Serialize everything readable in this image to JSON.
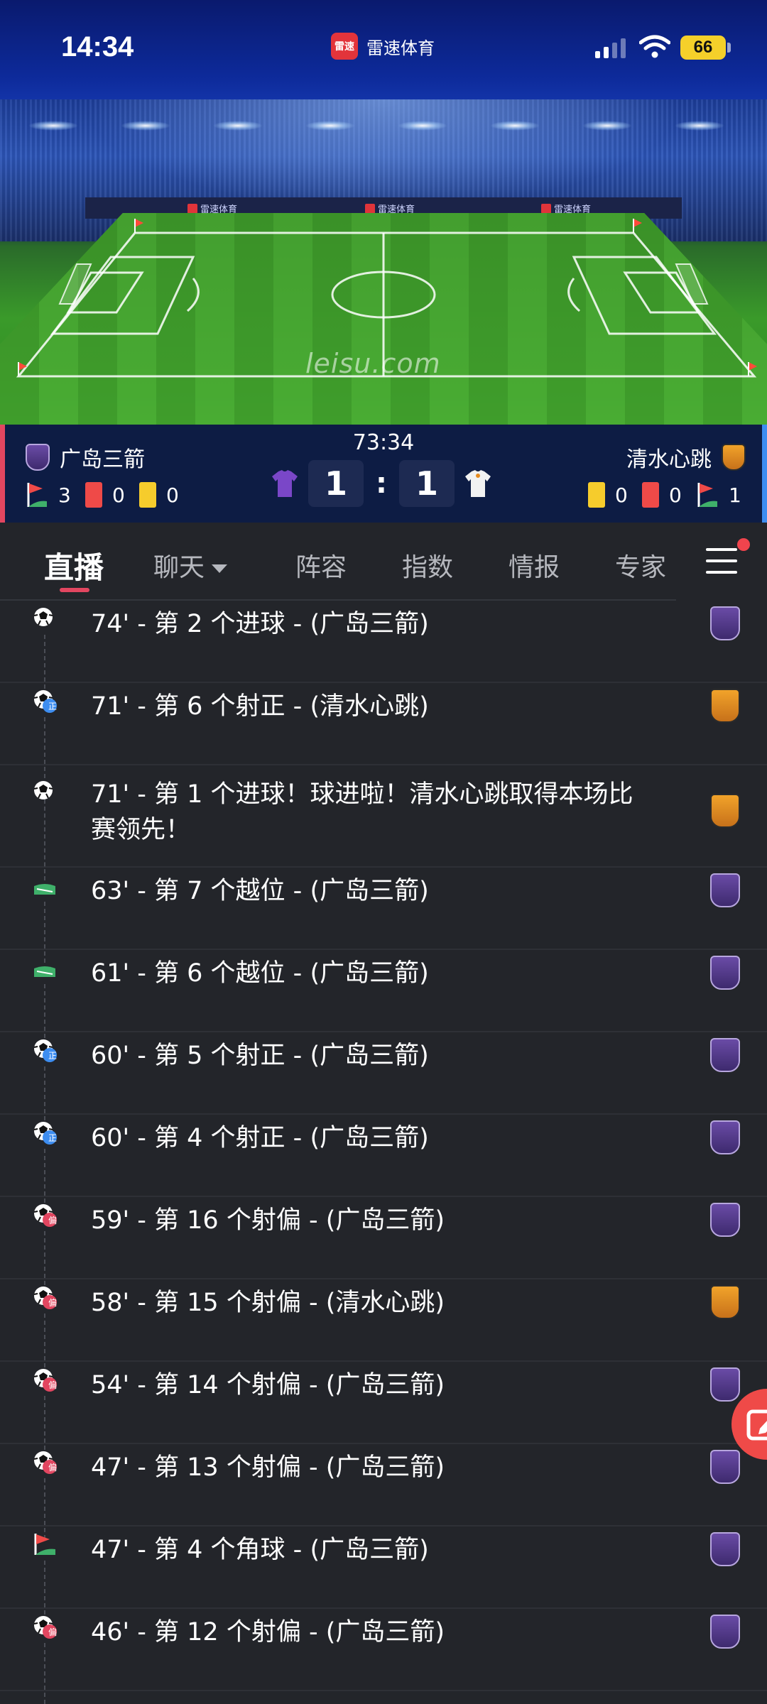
{
  "status_bar": {
    "time": "14:34",
    "app_name": "雷速体育",
    "app_logo_text": "雷速",
    "battery": "66"
  },
  "hero": {
    "watermark": "leisu.com",
    "adboard_text": "雷速体育"
  },
  "match": {
    "clock": "73:34",
    "home": {
      "name": "广岛三箭",
      "corners": "3",
      "red_cards": "0",
      "yellow_cards": "0",
      "score": "1",
      "crest_color": "#5a3f94"
    },
    "away": {
      "name": "清水心跳",
      "corners": "1",
      "red_cards": "0",
      "yellow_cards": "0",
      "score": "1",
      "crest_color": "#e58b20"
    },
    "colon": ":"
  },
  "tabs": [
    {
      "label": "直播",
      "active": true
    },
    {
      "label": "聊天",
      "has_dropdown": true
    },
    {
      "label": "阵容"
    },
    {
      "label": "指数"
    },
    {
      "label": "情报"
    },
    {
      "label": "专家"
    }
  ],
  "events": [
    {
      "text": "74' - 第 2 个进球 - (广岛三箭)",
      "icon": "football-icon",
      "team": "home"
    },
    {
      "text": "71' - 第 6 个射正 - (清水心跳)",
      "icon": "shot-on-target-icon",
      "badge": "正",
      "team": "away"
    },
    {
      "text": "71' - 第 1 个进球！球进啦！清水心跳取得本场比",
      "text2": "赛领先！",
      "icon": "football-icon",
      "team": "away"
    },
    {
      "text": "63' - 第 7 个越位 - (广岛三箭)",
      "icon": "offside-icon",
      "team": "home"
    },
    {
      "text": "61' - 第 6 个越位 - (广岛三箭)",
      "icon": "offside-icon",
      "team": "home"
    },
    {
      "text": "60' - 第 5 个射正 - (广岛三箭)",
      "icon": "shot-on-target-icon",
      "badge": "正",
      "team": "home"
    },
    {
      "text": "60' - 第 4 个射正 - (广岛三箭)",
      "icon": "shot-on-target-icon",
      "badge": "正",
      "team": "home"
    },
    {
      "text": "59' - 第 16 个射偏 - (广岛三箭)",
      "icon": "shot-off-target-icon",
      "badge": "偏",
      "team": "home"
    },
    {
      "text": "58' - 第 15 个射偏 - (清水心跳)",
      "icon": "shot-off-target-icon",
      "badge": "偏",
      "team": "away"
    },
    {
      "text": "54' - 第 14 个射偏 - (广岛三箭)",
      "icon": "shot-off-target-icon",
      "badge": "偏",
      "team": "home"
    },
    {
      "text": "47' - 第 13 个射偏 - (广岛三箭)",
      "icon": "shot-off-target-icon",
      "badge": "偏",
      "team": "home"
    },
    {
      "text": "47' - 第 4 个角球 - (广岛三箭)",
      "icon": "corner-flag-icon",
      "team": "home"
    },
    {
      "text": "46' - 第 12 个射偏 - (广岛三箭)",
      "icon": "shot-off-target-icon",
      "badge": "偏",
      "team": "home"
    }
  ],
  "colors": {
    "accent_red": "#e24660",
    "accent_blue": "#3d8df0",
    "badge_on_target": "#3d8df0",
    "badge_off_target": "#e24660"
  }
}
